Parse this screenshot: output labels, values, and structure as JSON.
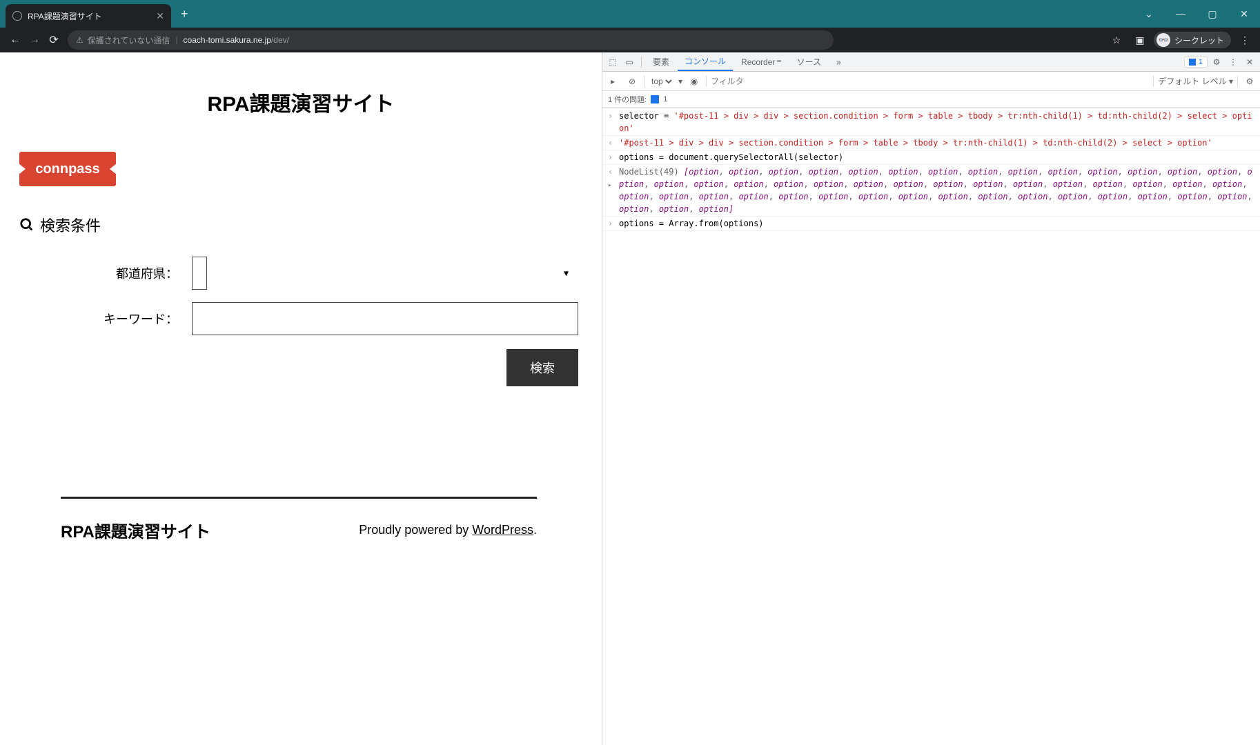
{
  "browser": {
    "tab_title": "RPA課題演習サイト",
    "insecure_label": "保護されていない通信",
    "url_host": "coach-tomi.sakura.ne.jp",
    "url_path": "/dev/",
    "incognito_label": "シークレット"
  },
  "page": {
    "title": "RPA課題演習サイト",
    "logo_text": "connpass",
    "search_heading": "検索条件",
    "prefecture_label": "都道府県：",
    "keyword_label": "キーワード：",
    "search_button": "検索",
    "footer_title": "RPA課題演習サイト",
    "footer_powered": "Proudly powered by ",
    "footer_link": "WordPress",
    "footer_dot": "."
  },
  "devtools": {
    "tabs": {
      "elements": "要素",
      "console": "コンソール",
      "recorder": "Recorder",
      "sources": "ソース"
    },
    "issue_count": "1",
    "sub": {
      "top": "top",
      "filter_placeholder": "フィルタ",
      "level": "デフォルト レベル"
    },
    "issues_row": {
      "text": "1 件の問題:",
      "count": "1"
    },
    "lines": {
      "l1a": "selector = ",
      "l1b": "'#post-11 > div > div > section.condition > form > table > tbody > tr:nth-child(1) > td:nth-child(2) > select > option'",
      "l2": "'#post-11 > div > div > section.condition > form > table > tbody > tr:nth-child(1) > td:nth-child(2) > select > option'",
      "l3": "options = document.querySelectorAll(selector)",
      "l4a": "NodeList(49) ",
      "l4b": "[",
      "opt": "option",
      "l4c": "]",
      "l5": "options = Array.from(options)"
    }
  }
}
